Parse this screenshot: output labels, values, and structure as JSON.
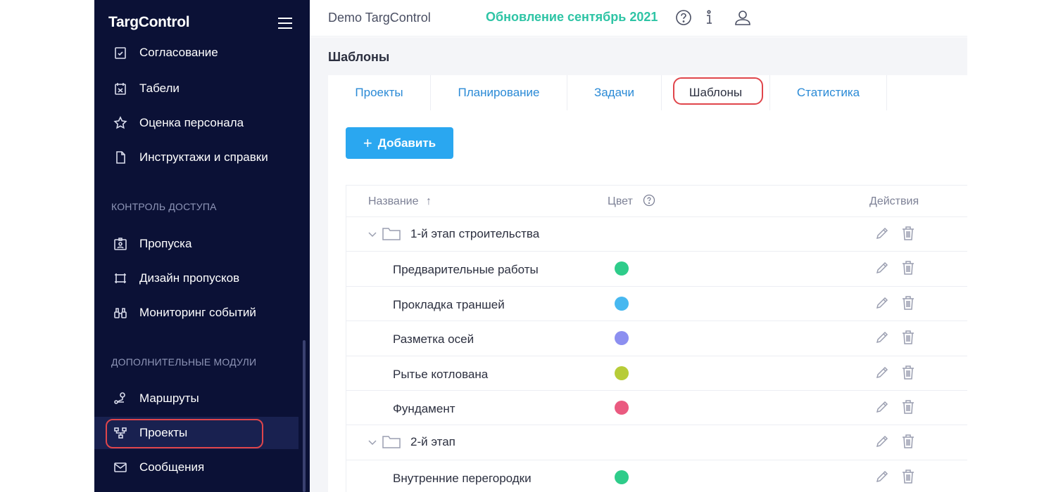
{
  "sidebar": {
    "logo": "TargControl",
    "partial_item": "Согласование",
    "items_top": [
      {
        "label": "Табели",
        "icon": "timesheet-icon"
      },
      {
        "label": "Оценка персонала",
        "icon": "star-icon"
      },
      {
        "label": "Инструктажи и справки",
        "icon": "document-icon"
      }
    ],
    "section_access": "КОНТРОЛЬ ДОСТУПА",
    "items_access": [
      {
        "label": "Пропуска",
        "icon": "badge-icon"
      },
      {
        "label": "Дизайн пропусков",
        "icon": "design-icon"
      },
      {
        "label": "Мониторинг событий",
        "icon": "binoculars-icon"
      }
    ],
    "section_modules": "ДОПОЛНИТЕЛЬНЫЕ МОДУЛИ",
    "items_modules": [
      {
        "label": "Маршруты",
        "icon": "route-icon"
      },
      {
        "label": "Проекты",
        "icon": "projects-icon",
        "active": true
      },
      {
        "label": "Сообщения",
        "icon": "mail-icon"
      }
    ]
  },
  "topbar": {
    "app_name": "Demo TargControl",
    "update_link": "Обновление сентябрь 2021",
    "icons": [
      "help-icon",
      "info-icon",
      "user-icon"
    ]
  },
  "main": {
    "title": "Шаблоны",
    "tabs": [
      {
        "label": "Проекты"
      },
      {
        "label": "Планирование"
      },
      {
        "label": "Задачи"
      },
      {
        "label": "Шаблоны",
        "active": true
      },
      {
        "label": "Статистика"
      }
    ],
    "add_button": "Добавить",
    "table": {
      "col_name": "Название",
      "sort_indicator": "↑",
      "col_color": "Цвет",
      "col_actions": "Действия",
      "rows": [
        {
          "type": "group",
          "name": "1-й этап строительства"
        },
        {
          "type": "item",
          "name": "Предварительные работы",
          "color": "#2ecc8a"
        },
        {
          "type": "item",
          "name": "Прокладка траншей",
          "color": "#47b8f0"
        },
        {
          "type": "item",
          "name": "Разметка осей",
          "color": "#8c8ff0"
        },
        {
          "type": "item",
          "name": "Рытье котлована",
          "color": "#b7cc38"
        },
        {
          "type": "item",
          "name": "Фундамент",
          "color": "#ea5a80"
        },
        {
          "type": "group",
          "name": "2-й этап"
        },
        {
          "type": "item",
          "name": "Внутренние перегородки",
          "color": "#2ecc8a"
        }
      ]
    }
  }
}
